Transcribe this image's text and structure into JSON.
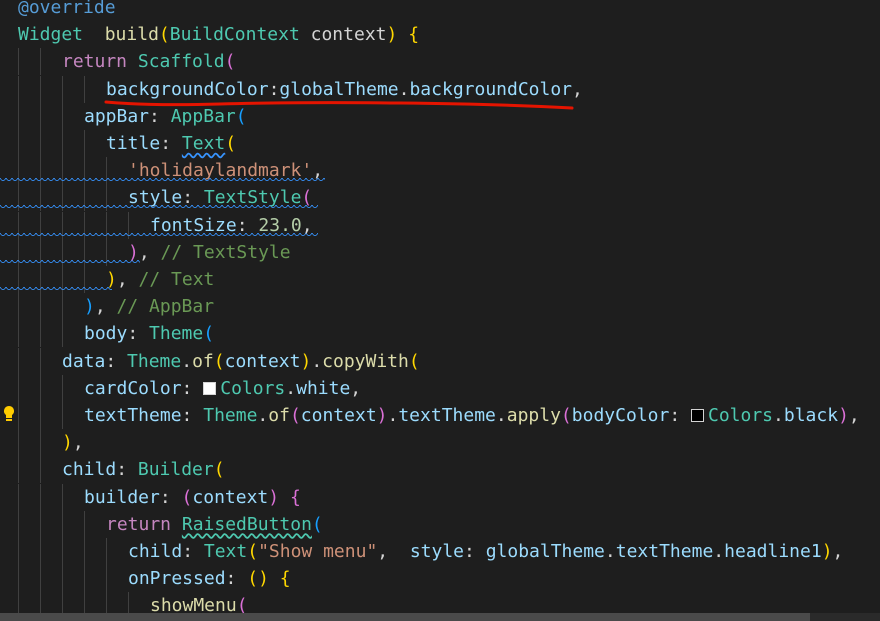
{
  "editor": {
    "theme_colors": {
      "background": "#1e1e1e",
      "keyword": "#569cd6",
      "control": "#c586c0",
      "type": "#4ec9b0",
      "function": "#dcdcaa",
      "property": "#9cdcfe",
      "string": "#ce9178",
      "number": "#b5cea8",
      "comment": "#6a9955",
      "annotation_underline": "#e51400"
    },
    "lines": [
      {
        "t": [
          [
            "ano",
            "@override"
          ]
        ]
      },
      {
        "t": [
          [
            "ty",
            "Widget"
          ],
          [
            "",
            "  "
          ],
          [
            "fn",
            "build"
          ],
          [
            "br1",
            "("
          ],
          [
            "ty",
            "BuildContext"
          ],
          [
            "",
            " context"
          ],
          [
            "br1",
            ")"
          ],
          [
            "",
            " "
          ],
          [
            "br1",
            "{"
          ]
        ]
      },
      {
        "t": [
          [
            "ctl",
            "return"
          ],
          [
            "",
            " "
          ],
          [
            "ty",
            "Scaffold"
          ],
          [
            "br2",
            "("
          ]
        ]
      },
      {
        "t": [
          [
            "prop",
            "backgroundColor"
          ],
          [
            "",
            ":"
          ],
          [
            "prop",
            "globalTheme"
          ],
          [
            "",
            "."
          ],
          [
            "prop",
            "backgroundColor"
          ],
          [
            "",
            ","
          ]
        ]
      },
      {
        "t": [
          [
            "prop",
            "appBar"
          ],
          [
            "",
            ": "
          ],
          [
            "ty",
            "AppBar"
          ],
          [
            "br3",
            "("
          ]
        ]
      },
      {
        "t": [
          [
            "prop",
            "title"
          ],
          [
            "",
            ": "
          ],
          [
            "ty",
            "Text"
          ],
          [
            "br1",
            "("
          ]
        ]
      },
      {
        "t": [
          [
            "str",
            "'holidaylandmark'"
          ],
          [
            "",
            ","
          ]
        ]
      },
      {
        "t": [
          [
            "prop",
            "style"
          ],
          [
            "",
            ": "
          ],
          [
            "ty",
            "TextStyle"
          ],
          [
            "br2",
            "("
          ]
        ]
      },
      {
        "t": [
          [
            "prop",
            "fontSize"
          ],
          [
            "",
            ": "
          ],
          [
            "num",
            "23.0"
          ],
          [
            "",
            ","
          ]
        ]
      },
      {
        "t": [
          [
            "br2",
            ")"
          ],
          [
            "",
            ", "
          ],
          [
            "cm",
            "// TextStyle"
          ]
        ]
      },
      {
        "t": [
          [
            "br1",
            ")"
          ],
          [
            "",
            ", "
          ],
          [
            "cm",
            "// Text"
          ]
        ]
      },
      {
        "t": [
          [
            "br3",
            ")"
          ],
          [
            "",
            ", "
          ],
          [
            "cm",
            "// AppBar"
          ]
        ]
      },
      {
        "t": [
          [
            "prop",
            "body"
          ],
          [
            "",
            ": "
          ],
          [
            "ty",
            "Theme"
          ],
          [
            "br3",
            "("
          ]
        ]
      },
      {
        "t": [
          [
            "prop",
            "data"
          ],
          [
            "",
            ": "
          ],
          [
            "ty",
            "Theme"
          ],
          [
            "",
            "."
          ],
          [
            "fn",
            "of"
          ],
          [
            "br1",
            "("
          ],
          [
            "prop",
            "context"
          ],
          [
            "br1",
            ")"
          ],
          [
            "",
            "."
          ],
          [
            "fn",
            "copyWith"
          ],
          [
            "br1",
            "("
          ]
        ]
      },
      {
        "t": [
          [
            "prop",
            "cardColor"
          ],
          [
            "",
            ": "
          ],
          [
            "swatch",
            "white"
          ],
          [
            "ty",
            "Colors"
          ],
          [
            "",
            "."
          ],
          [
            "prop",
            "white"
          ],
          [
            "",
            ","
          ]
        ]
      },
      {
        "t": [
          [
            "prop",
            "textTheme"
          ],
          [
            "",
            ": "
          ],
          [
            "ty",
            "Theme"
          ],
          [
            "",
            "."
          ],
          [
            "fn",
            "of"
          ],
          [
            "br2",
            "("
          ],
          [
            "prop",
            "context"
          ],
          [
            "br2",
            ")"
          ],
          [
            "",
            "."
          ],
          [
            "prop",
            "textTheme"
          ],
          [
            "",
            "."
          ],
          [
            "fn",
            "apply"
          ],
          [
            "br2",
            "("
          ],
          [
            "prop",
            "bodyColor"
          ],
          [
            "",
            ": "
          ],
          [
            "swatch",
            "black"
          ],
          [
            "ty",
            "Colors"
          ],
          [
            "",
            "."
          ],
          [
            "prop",
            "black"
          ],
          [
            "br2",
            ")"
          ],
          [
            "",
            ","
          ]
        ]
      },
      {
        "t": [
          [
            "br1",
            ")"
          ],
          [
            "",
            ","
          ]
        ]
      },
      {
        "t": [
          [
            "prop",
            "child"
          ],
          [
            "",
            ": "
          ],
          [
            "ty",
            "Builder"
          ],
          [
            "br1",
            "("
          ]
        ]
      },
      {
        "t": [
          [
            "prop",
            "builder"
          ],
          [
            "",
            ": "
          ],
          [
            "br2",
            "("
          ],
          [
            "prop",
            "context"
          ],
          [
            "br2",
            ")"
          ],
          [
            "",
            " "
          ],
          [
            "br2",
            "{"
          ]
        ]
      },
      {
        "t": [
          [
            "ctl",
            "return"
          ],
          [
            "",
            " "
          ],
          [
            "ty",
            "RaisedButton"
          ],
          [
            "br3",
            "("
          ]
        ]
      },
      {
        "t": [
          [
            "prop",
            "child"
          ],
          [
            "",
            ": "
          ],
          [
            "ty",
            "Text"
          ],
          [
            "br1",
            "("
          ],
          [
            "str",
            "\"Show menu\""
          ],
          [
            "",
            ",  "
          ],
          [
            "prop",
            "style"
          ],
          [
            "",
            ": "
          ],
          [
            "prop",
            "globalTheme"
          ],
          [
            "",
            "."
          ],
          [
            "prop",
            "textTheme"
          ],
          [
            "",
            "."
          ],
          [
            "prop",
            "headline1"
          ],
          [
            "br1",
            ")"
          ],
          [
            "",
            ","
          ]
        ]
      },
      {
        "t": [
          [
            "prop",
            "onPressed"
          ],
          [
            "",
            ": "
          ],
          [
            "br1",
            "("
          ],
          [
            "br1",
            ")"
          ],
          [
            "",
            " "
          ],
          [
            "br1",
            "{"
          ]
        ]
      },
      {
        "t": [
          [
            "fn",
            "showMenu"
          ],
          [
            "br2",
            "("
          ]
        ]
      }
    ]
  }
}
